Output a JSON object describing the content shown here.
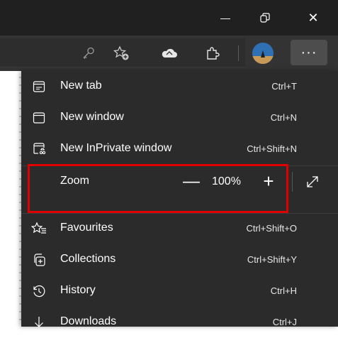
{
  "window_controls": {
    "minimize_glyph": "—",
    "restore_glyph": "❐",
    "close_glyph": "✕"
  },
  "toolbar": {
    "more_glyph": "···"
  },
  "menu": {
    "items": [
      {
        "label": "New tab",
        "shortcut": "Ctrl+T",
        "icon": "new-tab-icon"
      },
      {
        "label": "New window",
        "shortcut": "Ctrl+N",
        "icon": "new-window-icon"
      },
      {
        "label": "New InPrivate window",
        "shortcut": "Ctrl+Shift+N",
        "icon": "inprivate-icon"
      },
      {
        "label": "Favourites",
        "shortcut": "Ctrl+Shift+O",
        "icon": "favourites-icon"
      },
      {
        "label": "Collections",
        "shortcut": "Ctrl+Shift+Y",
        "icon": "collections-icon"
      },
      {
        "label": "History",
        "shortcut": "Ctrl+H",
        "icon": "history-icon"
      },
      {
        "label": "Downloads",
        "shortcut": "Ctrl+J",
        "icon": "downloads-icon"
      }
    ],
    "zoom": {
      "label": "Zoom",
      "minus": "—",
      "value": "100%",
      "plus": "+"
    }
  },
  "colors": {
    "menu_bg": "#2b2b2b",
    "titlebar_bg": "#202020",
    "highlight": "#e00000"
  }
}
